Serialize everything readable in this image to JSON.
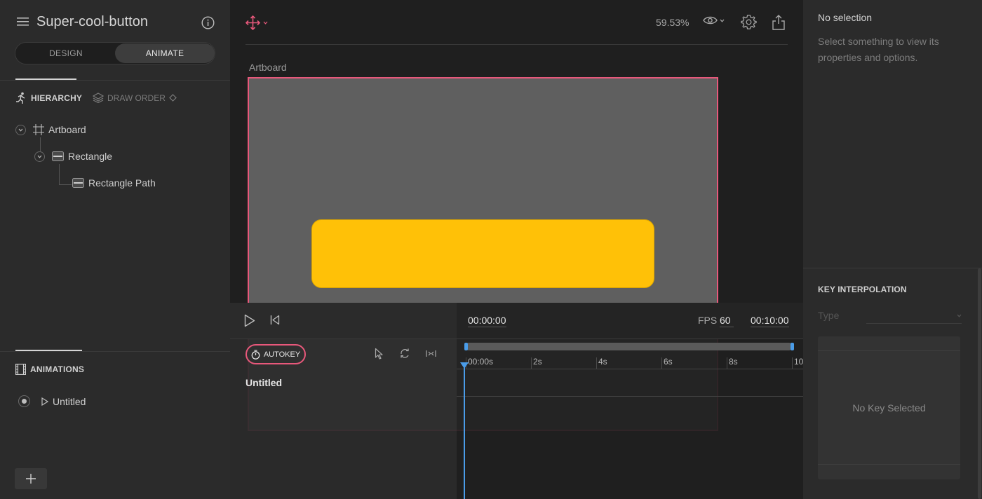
{
  "header": {
    "file_title": "Super-cool-button",
    "mode_tabs": [
      {
        "label": "DESIGN"
      },
      {
        "label": "ANIMATE"
      }
    ],
    "active_tab": "ANIMATE"
  },
  "hierarchy": {
    "tab_label": "HIERARCHY",
    "draw_order_label": "DRAW ORDER",
    "items": [
      {
        "label": "Artboard",
        "icon": "artboard-icon"
      },
      {
        "label": "Rectangle",
        "icon": "shape-icon"
      },
      {
        "label": "Rectangle Path",
        "icon": "path-icon"
      }
    ]
  },
  "animations": {
    "header_label": "ANIMATIONS",
    "items": [
      {
        "label": "Untitled"
      }
    ]
  },
  "toolbar": {
    "zoom": "59.53%"
  },
  "canvas": {
    "artboard_label": "Artboard",
    "artboard_border_color": "#e8587b",
    "artboard_fill": "#5f5f5f",
    "rectangle_fill": "#ffc107"
  },
  "timeline": {
    "current_time": "00:00:00",
    "fps_label": "FPS",
    "fps_value": "60",
    "duration": "00:10:00",
    "autokey_label": "AUTOKEY",
    "animation_name": "Untitled",
    "ticks": [
      "00:00s",
      "2s",
      "4s",
      "6s",
      "8s",
      "10"
    ],
    "playhead_color": "#4a9ce8"
  },
  "properties": {
    "no_selection_title": "No selection",
    "no_selection_hint": "Select something to view its properties and options.",
    "key_interpolation_label": "KEY INTERPOLATION",
    "type_placeholder": "Type",
    "no_key_label": "No Key Selected"
  }
}
